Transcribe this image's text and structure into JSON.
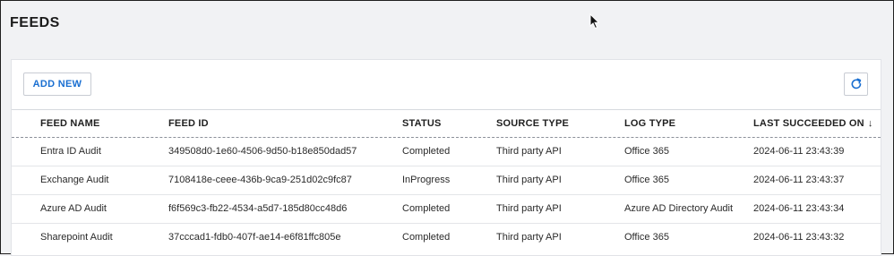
{
  "page": {
    "title": "FEEDS"
  },
  "toolbar": {
    "add_new_label": "ADD NEW",
    "refresh_icon": "refresh-icon"
  },
  "table": {
    "columns": [
      "FEED NAME",
      "FEED ID",
      "STATUS",
      "SOURCE TYPE",
      "LOG TYPE",
      "LAST SUCCEEDED ON"
    ],
    "sort_indicator": "↓",
    "rows": [
      {
        "feed_name": "Entra ID Audit",
        "feed_id": "349508d0-1e60-4506-9d50-b18e850dad57",
        "status": "Completed",
        "source_type": "Third party API",
        "log_type": "Office 365",
        "last_succeeded_on": "2024-06-11 23:43:39"
      },
      {
        "feed_name": "Exchange Audit",
        "feed_id": "7108418e-ceee-436b-9ca9-251d02c9fc87",
        "status": "InProgress",
        "source_type": "Third party API",
        "log_type": "Office 365",
        "last_succeeded_on": "2024-06-11 23:43:37"
      },
      {
        "feed_name": "Azure AD Audit",
        "feed_id": "f6f569c3-fb22-4534-a5d7-185d80cc48d6",
        "status": "Completed",
        "source_type": "Third party API",
        "log_type": "Azure AD Directory Audit",
        "last_succeeded_on": "2024-06-11 23:43:34"
      },
      {
        "feed_name": "Sharepoint Audit",
        "feed_id": "37cccad1-fdb0-407f-ae14-e6f81ffc805e",
        "status": "Completed",
        "source_type": "Third party API",
        "log_type": "Office 365",
        "last_succeeded_on": "2024-06-11 23:43:32"
      }
    ]
  },
  "colors": {
    "accent": "#1a6fd1",
    "background": "#f1f2f4",
    "panel": "#ffffff"
  }
}
